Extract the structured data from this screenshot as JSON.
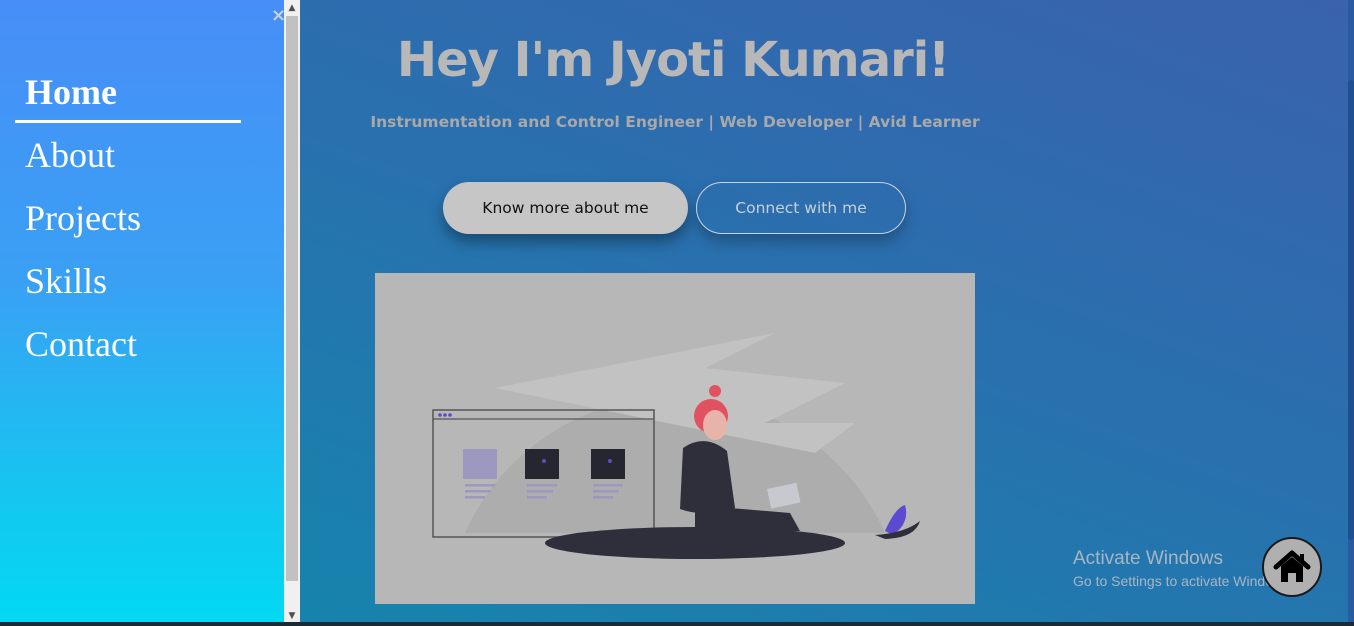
{
  "sidebar": {
    "close_label": "×",
    "items": [
      {
        "label": "Home"
      },
      {
        "label": "About"
      },
      {
        "label": "Projects"
      },
      {
        "label": "Skills"
      },
      {
        "label": "Contact"
      }
    ],
    "active": "Home"
  },
  "hero": {
    "title": "Hey I'm Jyoti Kumari!",
    "subtitle": "Instrumentation and Control Engineer | Web Developer | Avid Learner",
    "primary_button": "Know more about me",
    "secondary_button": "Connect with me"
  },
  "watermark": {
    "title": "Activate Windows",
    "subtitle": "Go to Settings to activate Windows."
  },
  "icons": {
    "close": "close-icon",
    "home": "home-icon",
    "scroll_up": "scroll-up-icon",
    "scroll_down": "scroll-down-icon"
  },
  "colors": {
    "sidebar_top": "#478ef7",
    "sidebar_bottom": "#02d9f2",
    "main_background": "#2a6fae",
    "title_text": "#b8b8b8",
    "illustration_bg": "#b7b7b7",
    "accent_pink": "#e0525f",
    "accent_purple": "#5a4bd1"
  }
}
